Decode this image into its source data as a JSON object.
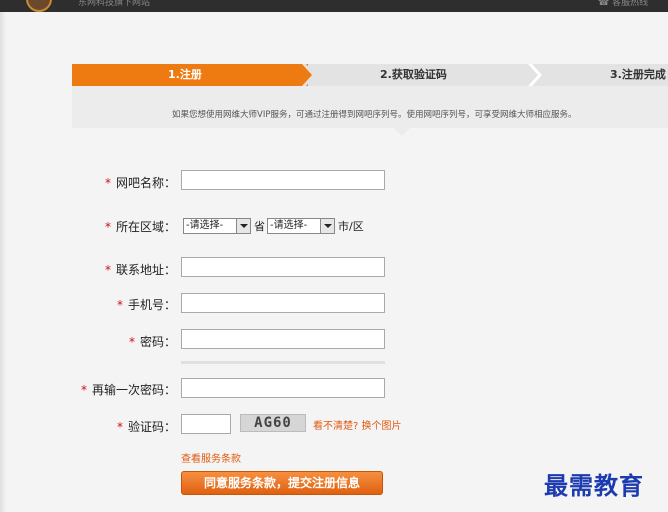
{
  "header": {
    "site_title": "东网科技旗下网站",
    "service": "客服热线"
  },
  "steps": [
    {
      "label": "1.注册",
      "active": true
    },
    {
      "label": "2.获取验证码",
      "active": false
    },
    {
      "label": "3.注册完成",
      "active": false
    }
  ],
  "intro": "如果您想使用网维大师VIP服务，可通过注册得到网吧序列号。使用网吧序列号，可享受网维大师相应服务。",
  "form": {
    "required_mark": "*",
    "cafe_name_label": "网吧名称：",
    "region_label": "所在区域：",
    "province_select": "-请选择-",
    "province_unit": "省",
    "city_select": "-请选择-",
    "city_unit": "市/区",
    "address_label": "联系地址：",
    "phone_label": "手机号：",
    "password_label": "密码：",
    "password_confirm_label": "再输一次密码：",
    "captcha_label": "验证码：",
    "captcha_text": "AG60",
    "captcha_refresh": "看不清楚? 换个图片",
    "terms_link": "查看服务条款",
    "submit_label": "同意服务条款，提交注册信息"
  },
  "watermark": "最需教育",
  "colors": {
    "accent": "#ee7a12",
    "required": "#cc1111",
    "link": "#e05a10",
    "watermark": "#1d3bb0"
  }
}
